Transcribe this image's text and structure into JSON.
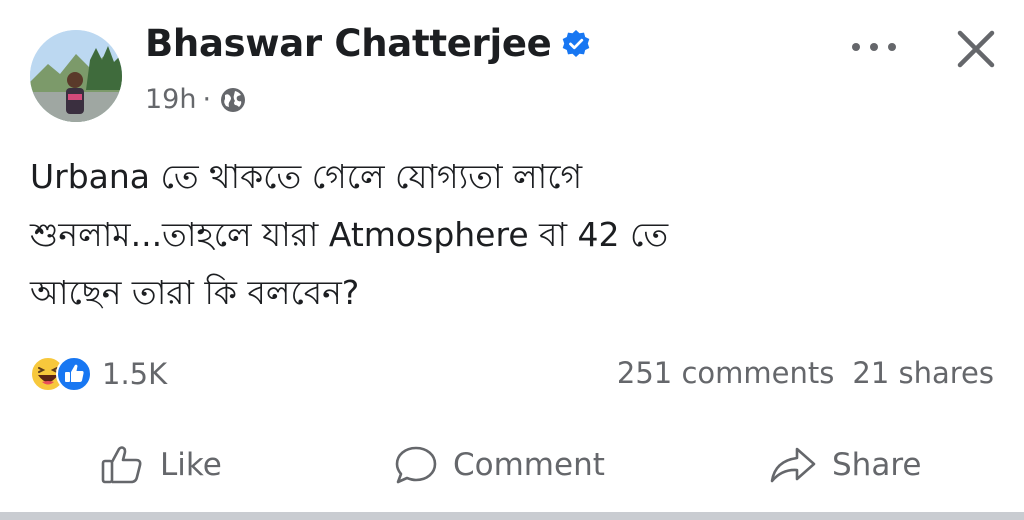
{
  "post": {
    "author": {
      "name": "Bhaswar Chatterjee",
      "verified": true,
      "avatar_icon": "profile-photo"
    },
    "timestamp": "19h",
    "separator": "·",
    "audience_icon": "globe-icon",
    "text_lines": [
      "Urbana তে থাকতে গেলে যোগ্যতা লাগে",
      "শুনলাম...তাহলে যারা Atmosphere বা 42 তে",
      "আছেন তারা কি বলবেন?"
    ]
  },
  "stats": {
    "reaction_icons": [
      "haha-reaction-icon",
      "like-reaction-icon"
    ],
    "reaction_count": "1.5K",
    "comments": "251 comments",
    "shares": "21 shares"
  },
  "actions": {
    "like": "Like",
    "comment": "Comment",
    "share": "Share"
  },
  "colors": {
    "text": "#1c1e21",
    "secondary": "#65676b",
    "brand_blue": "#1877f2",
    "haha_yellow": "#f7c83c"
  }
}
